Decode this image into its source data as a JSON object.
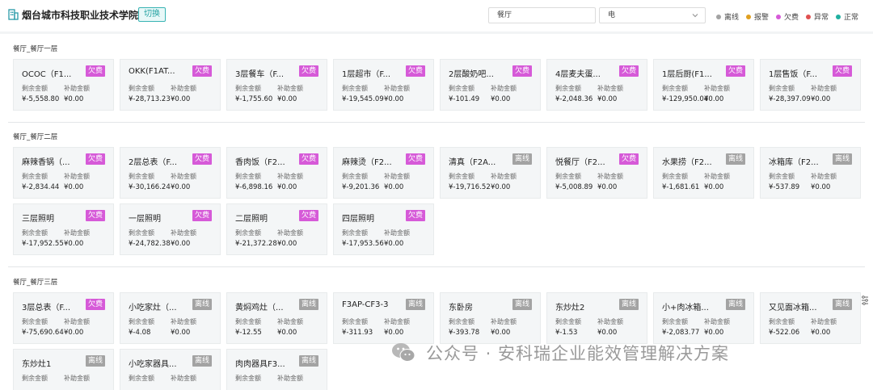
{
  "header": {
    "title": "烟台城市科技职业技术学院",
    "switch_label": "切换",
    "filter_category": "餐厅",
    "filter_type": "电"
  },
  "legend": [
    {
      "label": "离线",
      "color": "#a3a3a3"
    },
    {
      "label": "报警",
      "color": "#e0a020"
    },
    {
      "label": "欠费",
      "color": "#d65ad8"
    },
    {
      "label": "异常",
      "color": "#e05050"
    },
    {
      "label": "正常",
      "color": "#20b0a0"
    }
  ],
  "card_labels": {
    "balance": "剩余金额",
    "subsidy": "补助金额"
  },
  "sections": [
    {
      "title": "餐厅_餐厅一层",
      "cards": [
        {
          "name": "OCOC（F1...",
          "status": "欠费",
          "balance": "¥-5,558.80",
          "subsidy": "¥0.00"
        },
        {
          "name": "OKK(F1AT...",
          "status": "欠费",
          "balance": "¥-28,713.23",
          "subsidy": "¥0.00"
        },
        {
          "name": "3层餐车（F...",
          "status": "欠费",
          "balance": "¥-1,755.60",
          "subsidy": "¥0.00"
        },
        {
          "name": "1层超市（F...",
          "status": "欠费",
          "balance": "¥-19,545.09",
          "subsidy": "¥0.00"
        },
        {
          "name": "2层酸奶吧...",
          "status": "欠费",
          "balance": "¥-101.49",
          "subsidy": "¥0.00"
        },
        {
          "name": "4层麦夫蛋...",
          "status": "欠费",
          "balance": "¥-2,048.36",
          "subsidy": "¥0.00"
        },
        {
          "name": "1层后厨(F1...",
          "status": "欠费",
          "balance": "¥-129,950.04",
          "subsidy": "¥0.00"
        },
        {
          "name": "1层售饭（F...",
          "status": "欠费",
          "balance": "¥-28,397.09",
          "subsidy": "¥0.00"
        }
      ]
    },
    {
      "title": "餐厅_餐厅二层",
      "cards": [
        {
          "name": "麻辣香锅（...",
          "status": "欠费",
          "balance": "¥-2,834.44",
          "subsidy": "¥0.00"
        },
        {
          "name": "2层总表（F...",
          "status": "欠费",
          "balance": "¥-30,166.24",
          "subsidy": "¥0.00"
        },
        {
          "name": "香肉饭（F2...",
          "status": "欠费",
          "balance": "¥-6,898.16",
          "subsidy": "¥0.00"
        },
        {
          "name": "麻辣烫（F2...",
          "status": "欠费",
          "balance": "¥-9,201.36",
          "subsidy": "¥0.00"
        },
        {
          "name": "清真（F2A...",
          "status": "离线",
          "balance": "¥-19,716.52",
          "subsidy": "¥0.00"
        },
        {
          "name": "悦餐厅（F2...",
          "status": "欠费",
          "balance": "¥-5,008.89",
          "subsidy": "¥0.00"
        },
        {
          "name": "水果捞（F2...",
          "status": "离线",
          "balance": "¥-1,681.61",
          "subsidy": "¥0.00"
        },
        {
          "name": "冰箱库（F2...",
          "status": "离线",
          "balance": "¥-537.89",
          "subsidy": "¥0.00"
        },
        {
          "name": "三层照明",
          "status": "欠费",
          "balance": "¥-17,952.55",
          "subsidy": "¥0.00"
        },
        {
          "name": "一层照明",
          "status": "欠费",
          "balance": "¥-24,782.38",
          "subsidy": "¥0.00"
        },
        {
          "name": "二层照明",
          "status": "欠费",
          "balance": "¥-21,372.28",
          "subsidy": "¥0.00"
        },
        {
          "name": "四层照明",
          "status": "欠费",
          "balance": "¥-17,953.56",
          "subsidy": "¥0.00"
        }
      ]
    },
    {
      "title": "餐厅_餐厅三层",
      "cards": [
        {
          "name": "3层总表（F...",
          "status": "欠费",
          "balance": "¥-75,690.64",
          "subsidy": "¥0.00"
        },
        {
          "name": "小吃家灶（...",
          "status": "离线",
          "balance": "¥-4.08",
          "subsidy": "¥0.00"
        },
        {
          "name": "黄焖鸡灶（...",
          "status": "离线",
          "balance": "¥-12.55",
          "subsidy": "¥0.00"
        },
        {
          "name": "F3AP-CF3-3",
          "status": "离线",
          "balance": "¥-311.93",
          "subsidy": "¥0.00"
        },
        {
          "name": "东卧房",
          "status": "离线",
          "balance": "¥-393.78",
          "subsidy": "¥0.00"
        },
        {
          "name": "东炒灶2",
          "status": "离线",
          "balance": "¥-1.53",
          "subsidy": "¥0.00"
        },
        {
          "name": "小+肉冰箱...",
          "status": "离线",
          "balance": "¥-2,083.77",
          "subsidy": "¥0.00"
        },
        {
          "name": "又见面冰箱...",
          "status": "离线",
          "balance": "¥-522.06",
          "subsidy": "¥0.00"
        },
        {
          "name": "东炒灶1",
          "status": "离线",
          "balance": "",
          "subsidy": ""
        },
        {
          "name": "小吃家器具...",
          "status": "离线",
          "balance": "",
          "subsidy": ""
        },
        {
          "name": "肉肉器具F3...",
          "status": "离线",
          "balance": "",
          "subsidy": ""
        }
      ]
    }
  ],
  "watermark": {
    "text": "公众号 · 安科瑞企业能效管理解决方案",
    "icon": "wechat-icon"
  }
}
